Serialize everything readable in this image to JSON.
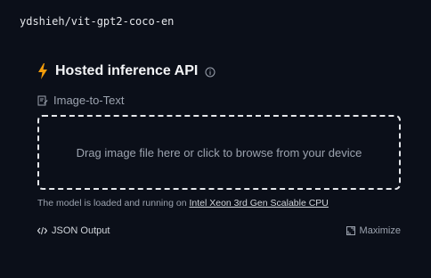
{
  "model_id": "ydshieh/vit-gpt2-coco-en",
  "widget": {
    "title": "Hosted inference API",
    "task": "Image-to-Text",
    "dropzone_text": "Drag image file here or click to browse from your device",
    "status_prefix": "The model is loaded and running on",
    "status_hardware": "Intel Xeon 3rd Gen Scalable CPU",
    "json_output_label": "JSON Output",
    "maximize_label": "Maximize"
  },
  "colors": {
    "background": "#0b0f19",
    "accent_bolt": "#f59e0b",
    "text_primary": "#f3f4f6",
    "text_muted": "#9ca3af",
    "dropzone_border": "#e5e7eb"
  },
  "icons": {
    "header": "lightning-bolt-icon",
    "info": "info-circle-icon",
    "task": "image-to-text-icon",
    "json": "code-brackets-icon",
    "maximize": "maximize-icon"
  }
}
